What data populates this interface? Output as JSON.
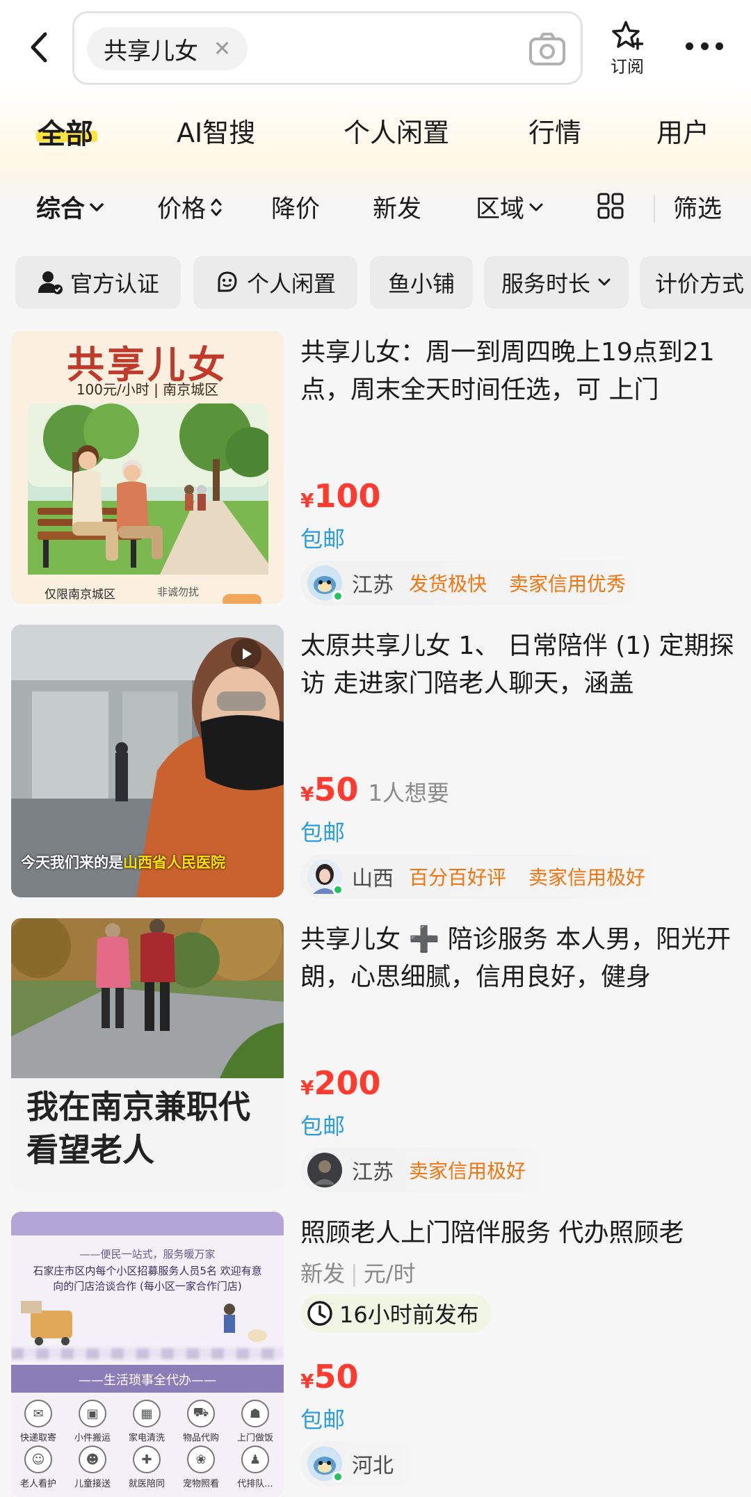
{
  "header": {
    "search_query": "共享儿女",
    "subscribe_label": "订阅"
  },
  "tabs": [
    "全部",
    "AI智搜",
    "个人闲置",
    "行情",
    "用户"
  ],
  "sort_bar": {
    "items": [
      "综合",
      "价格",
      "降价",
      "新发",
      "区域"
    ],
    "filter_label": "筛选"
  },
  "filter_chips": [
    "官方认证",
    "个人闲置",
    "鱼小铺",
    "服务时长",
    "计价方式"
  ],
  "listings": [
    {
      "title": "共享儿女：周一到周四晚上19点到21点，周末全天时间任选，可 上门",
      "price_symbol": "¥",
      "price": "100",
      "shipping": "包邮",
      "region": "江苏",
      "tags": [
        "发货极快",
        "卖家信用优秀"
      ],
      "thumb": {
        "title": "共享儿女",
        "subtitle": "100元/小时 | 南京城区",
        "footer": "仅限南京城区",
        "footer2": "非诚勿扰"
      }
    },
    {
      "title": "太原共享儿女 1、 日常陪伴 (1) 定期探访 走进家门陪老人聊天，涵盖",
      "price_symbol": "¥",
      "price": "50",
      "wants": "1人想要",
      "shipping": "包邮",
      "region": "山西",
      "tags": [
        "百分百好评",
        "卖家信用极好"
      ],
      "thumb": {
        "caption_prefix": "今天我们来的是",
        "caption_highlight": "山西省人民医院"
      }
    },
    {
      "title": "共享儿女 ➕ 陪诊服务 本人男，阳光开朗，心思细腻，信用良好，健身",
      "price_symbol": "¥",
      "price": "200",
      "shipping": "包邮",
      "region": "江苏",
      "tags": [
        "卖家信用极好"
      ],
      "thumb": {
        "text": "我在南京兼职代看望老人"
      }
    },
    {
      "title": "照顾老人上门陪伴服务 代办照顾老",
      "meta": [
        "新发",
        "元/时"
      ],
      "posted": "16小时前发布",
      "price_symbol": "¥",
      "price": "50",
      "shipping": "包邮",
      "region": "河北",
      "tags": [],
      "thumb": {
        "line1": "——便民一站式，服务暖万家",
        "line2": "石家庄市区内每个小区招募服务人员5名 欢迎有意向的门店洽谈合作 (每小区一家合作门店)",
        "band": "——生活琐事全代办——",
        "services": [
          "快递取寄",
          "小件搬运",
          "家电清洗",
          "物品代购",
          "上门做饭",
          "老人看护",
          "儿童接送",
          "就医陪同",
          "宠物照看",
          "代排队..."
        ]
      }
    }
  ],
  "colors": {
    "price": "#ff3b30",
    "shipping": "#2a9de0",
    "tag": "#f2750e",
    "tab_highlight": "#ffe340",
    "online": "#25c35f"
  },
  "icons": {
    "back": "chevron-left-icon",
    "camera": "camera-icon",
    "subscribe": "star-plus-icon",
    "more": "more-dots-icon",
    "grid": "grid-view-icon",
    "clock": "clock-icon"
  }
}
